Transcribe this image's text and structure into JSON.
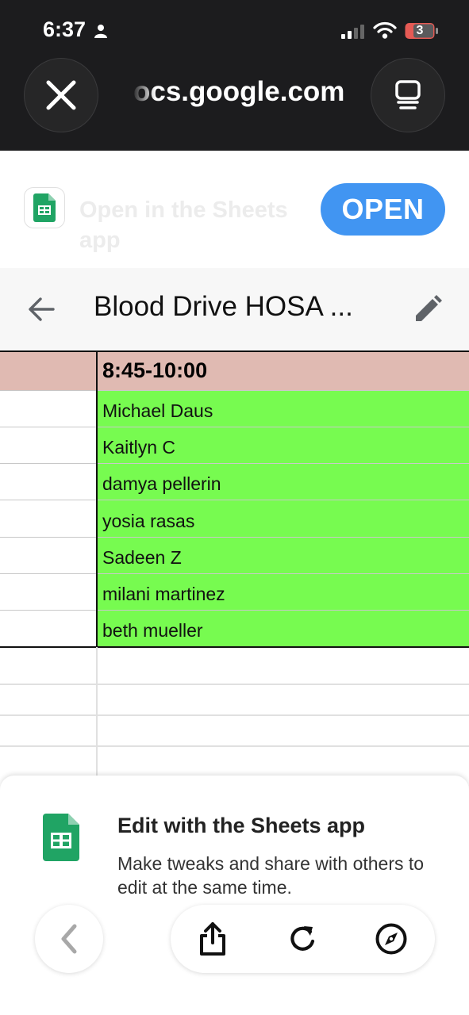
{
  "status_bar": {
    "time": "6:37",
    "battery": "3"
  },
  "browser": {
    "url": "ocs.google.com"
  },
  "banner": {
    "text": "Open in the Sheets app",
    "open_label": "OPEN"
  },
  "header": {
    "title": "Blood Drive HOSA ..."
  },
  "sheet": {
    "header_cell": "8:45-10:00",
    "rows": [
      "Michael Daus",
      "Kaitlyn C",
      "damya pellerin",
      "yosia rasas",
      "Sadeen Z",
      "milani martinez",
      "beth mueller"
    ],
    "colors": {
      "header_fill": "#e0bab2",
      "name_fill": "#77fb50"
    }
  },
  "promo": {
    "title": "Edit with the Sheets app",
    "description": "Make tweaks and share with others to edit at the same time."
  },
  "icons": {
    "close": "close-icon",
    "reader": "reader-icon",
    "back": "back-arrow-icon",
    "edit": "pencil-icon",
    "share": "share-icon",
    "reload": "reload-icon",
    "compass": "compass-icon"
  }
}
